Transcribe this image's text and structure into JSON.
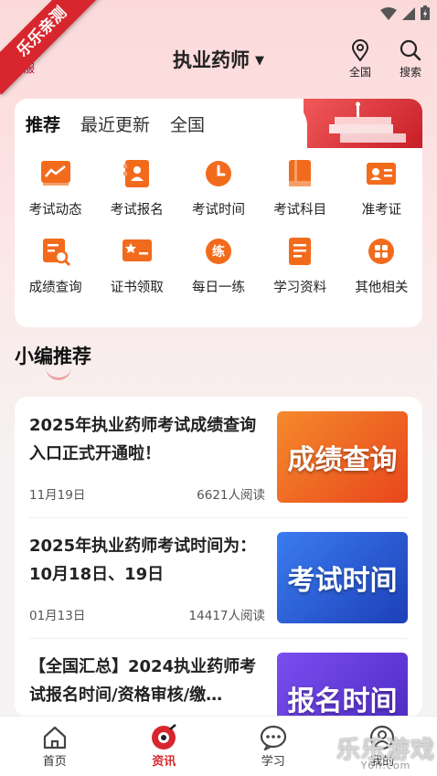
{
  "watermark_ribbon": "乐乐亲测",
  "header": {
    "kefu_label": "客服",
    "title": "执业药师",
    "region_label": "全国",
    "search_label": "搜索"
  },
  "tabs": [
    {
      "label": "推荐",
      "active": true
    },
    {
      "label": "最近更新",
      "active": false
    },
    {
      "label": "全国",
      "active": false
    }
  ],
  "grid": [
    {
      "label": "考试动态",
      "icon": "trend-icon"
    },
    {
      "label": "考试报名",
      "icon": "register-icon"
    },
    {
      "label": "考试时间",
      "icon": "clock-icon"
    },
    {
      "label": "考试科目",
      "icon": "book-icon"
    },
    {
      "label": "准考证",
      "icon": "id-card-icon"
    },
    {
      "label": "成绩查询",
      "icon": "score-search-icon"
    },
    {
      "label": "证书领取",
      "icon": "certificate-icon"
    },
    {
      "label": "每日一练",
      "icon": "practice-icon"
    },
    {
      "label": "学习资料",
      "icon": "document-icon"
    },
    {
      "label": "其他相关",
      "icon": "apps-icon"
    }
  ],
  "section": {
    "title": "小编推荐"
  },
  "news": [
    {
      "title": "2025年执业药师考试成绩查询入口正式开通啦！",
      "date": "11月19日",
      "reads": "6621人阅读",
      "thumb_text": "成绩查询",
      "thumb_color": "#f26b1d"
    },
    {
      "title": "2025年执业药师考试时间为：10月18日、19日",
      "date": "01月13日",
      "reads": "14417人阅读",
      "thumb_text": "考试时间",
      "thumb_color": "#2456d8"
    },
    {
      "title": "【全国汇总】2024执业药师考试报名时间/资格审核/缴…",
      "date": "",
      "reads": "",
      "thumb_text": "报名时间",
      "thumb_color": "#6a3ee0"
    }
  ],
  "bottom_nav": [
    {
      "label": "首页",
      "icon": "home-icon",
      "active": false
    },
    {
      "label": "资讯",
      "icon": "news-icon",
      "active": true
    },
    {
      "label": "学习",
      "icon": "chat-icon",
      "active": false
    },
    {
      "label": "我的",
      "icon": "user-icon",
      "active": false
    }
  ],
  "site_watermark": {
    "text": "乐乐游戏",
    "sub": "Y6ll.com"
  },
  "colors": {
    "accent": "#d8262e",
    "icon_orange": "#f26b1d"
  }
}
